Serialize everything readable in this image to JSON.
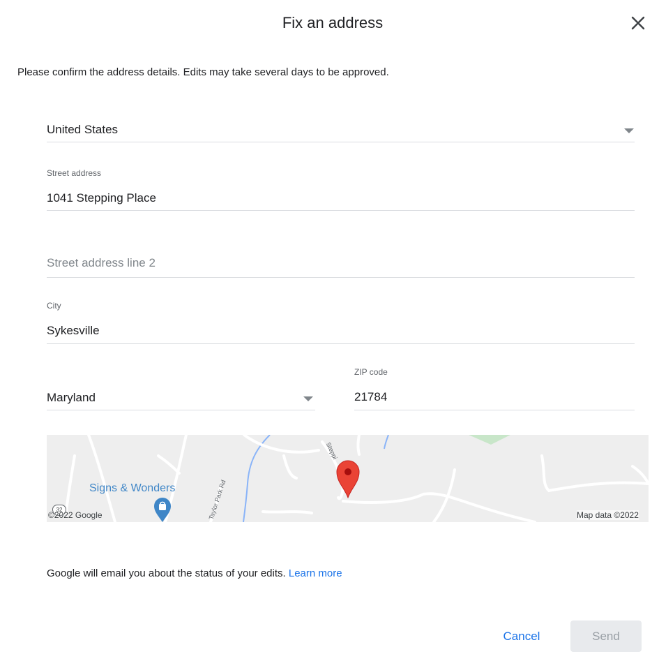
{
  "dialog": {
    "title": "Fix an address",
    "subtitle": "Please confirm the address details. Edits may take several days to be approved.",
    "close_icon": "close-icon"
  },
  "form": {
    "country": {
      "value": "United States"
    },
    "street": {
      "label": "Street address",
      "value": "1041 Stepping Place"
    },
    "street2": {
      "placeholder": "Street address line 2",
      "value": ""
    },
    "city": {
      "label": "City",
      "value": "Sykesville"
    },
    "state": {
      "value": "Maryland"
    },
    "zip": {
      "label": "ZIP code",
      "value": "21784"
    }
  },
  "map": {
    "poi_label": "Signs & Wonders",
    "road_label_1": "Taylor Park Rd",
    "road_label_2": "Steppi",
    "route_number": "32",
    "copyright_left": "©2022 Google",
    "copyright_right": "Map data ©2022",
    "pin_icon": "map-pin-icon",
    "poi_icon": "shopping-bag-icon"
  },
  "footer": {
    "note": "Google will email you about the status of your edits.",
    "learn_more": "Learn more",
    "cancel_label": "Cancel",
    "send_label": "Send"
  },
  "colors": {
    "accent": "#1a73e8",
    "pin": "#ea4335",
    "poi": "#3f86c7",
    "disabled_bg": "#e8eaed"
  }
}
